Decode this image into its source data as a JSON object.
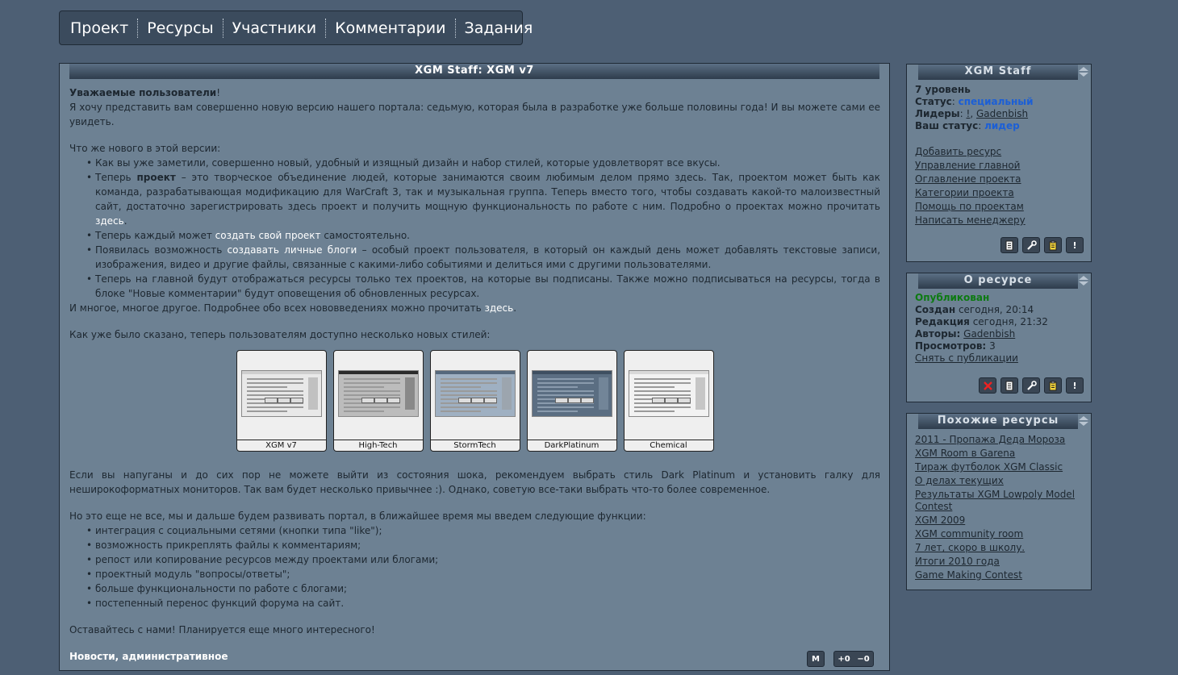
{
  "nav": {
    "items": [
      "Проект",
      "Ресурсы",
      "Участники",
      "Комментарии",
      "Задания"
    ]
  },
  "article": {
    "title": "XGM Staff: XGM v7",
    "greeting_bold": "Уважаемые пользователи",
    "greeting_rest": "!",
    "intro": "Я хочу представить вам совершенно новую версию нашего портала: седьмую, которая была в разработке уже больше половины года! И вы можете сами ее увидеть.",
    "whats_new": "Что же нового в этой версии:",
    "b1": "Как вы уже заметили, совершенно новый, удобный и изящный дизайн и набор стилей, которые удовлетворят все вкусы.",
    "b2_pre": "Теперь ",
    "b2_bold": "проект",
    "b2_text": " – это творческое объединение людей, которые занимаются своим любимым делом прямо здесь. Так, проектом может быть как команда, разрабатывающая модификацию для WarCraft 3, так и музыкальная группа. Теперь вместо того, чтобы создавать какой-то малоизвестный сайт, достаточно зарегистрировать здесь проект и получить мощную функциональность по работе с ним. Подробно о проектах можно прочитать ",
    "b2_link": "здесь",
    "b2_end": ".",
    "b3_pre": "Теперь каждый может ",
    "b3_link": "создать свой проект",
    "b3_end": " самостоятельно.",
    "b4_pre": "Появилась возможность ",
    "b4_link": "создавать личные блоги",
    "b4_end": " – особый проект пользователя, в который он каждый день может добавлять текстовые записи, изображения, видео и другие файлы, связанные с какими-либо событиями и делиться ими с другими пользователями.",
    "b5": "Теперь на главной будут отображаться ресурсы только тех проектов, на которые вы подписаны. Также можно подписываться на ресурсы, тогда в блоке \"Новые комментарии\" будут оповещения об обновленных ресурсах.",
    "more_pre": "И многое, многое другое. Подробнее обо всех нововведениях можно прочитать ",
    "more_link": "здесь",
    "more_end": ".",
    "styles_intro": "Как уже было сказано, теперь пользователям доступно несколько новых стилей:",
    "styles": [
      {
        "name": "XGM v7",
        "bg": "#e8e8e8",
        "bar": "#cfcfcf"
      },
      {
        "name": "High-Tech",
        "bg": "#bcbcbc",
        "bar": "#2b2b2b"
      },
      {
        "name": "StormTech",
        "bg": "#9fb0c2",
        "bar": "#55687c"
      },
      {
        "name": "DarkPlatinum",
        "bg": "#5b6e82",
        "bar": "#3e4f61"
      },
      {
        "name": "Chemical",
        "bg": "#f2f2f2",
        "bar": "#d9d9d9"
      }
    ],
    "shock": "Если вы напуганы и до сих пор не можете выйти из состояния шока, рекомендуем выбрать стиль Dark Platinum и установить галку для неширокоформатных мониторов. Так вам будет несколько привычнее :). Однако, советую все-таки выбрать что-то более современное.",
    "future_intro": "Но это еще не все, мы и дальше будем развивать портал, в ближайшее время мы введем следующие функции:",
    "future": [
      "интеграция с социальными сетями (кнопки типа \"like\");",
      "возможность прикреплять файлы к комментариям;",
      "репост или копирование ресурсов между проектами или блогами;",
      "проектный модуль \"вопросы/ответы\";",
      "больше функциональности по работе с блогами;",
      "постепенный перенос функций форума на сайт."
    ],
    "outro": "Оставайтесь с нами! Планируется еще много интересного!",
    "tag1": "Новости",
    "tag_sep": ", ",
    "tag2": "административное",
    "btn_m": "M",
    "btn_plus": "+0",
    "btn_minus": "−0"
  },
  "staff_panel": {
    "title": "XGM Staff",
    "level": "7 уровень",
    "status_label": "Статус",
    "status_value": "специальный",
    "leaders_label": "Лидеры",
    "leader1": "!",
    "leader2": "Gadenbish",
    "your_status_label": "Ваш статус",
    "your_status_value": "лидер",
    "colon": ":",
    "comma": ",",
    "links": [
      "Добавить ресурс",
      "Управление главной",
      "Оглавление проекта",
      "Категории проекта",
      "Помощь по проектам",
      "Написать менеджеру"
    ],
    "icon_names": [
      "document-icon",
      "wrench-icon",
      "clipboard-icon",
      "exclamation-icon"
    ]
  },
  "resource_panel": {
    "title": "О ресурсе",
    "published": "Опубликован",
    "created_label": "Создан",
    "created_value": "сегодня, 20:14",
    "edited_label": "Редакция",
    "edited_value": "сегодня, 21:32",
    "authors_label": "Авторы:",
    "author": "Gadenbish",
    "views_label": "Просмотров:",
    "views_value": "3",
    "unpublish": "Снять с публикации",
    "icon_names": [
      "delete-icon",
      "document-icon",
      "wrench-icon",
      "clipboard-icon",
      "exclamation-icon"
    ]
  },
  "similar_panel": {
    "title": "Похожие ресурсы",
    "items": [
      "2011 - Пропажа Деда Мороза",
      "XGM Room в Garena",
      "Тираж футболок XGM Classic",
      "О делах текущих",
      "Результаты XGM Lowpoly Model Contest",
      "XGM 2009",
      "XGM community room",
      "7 лет, скоро в школу.",
      "Итоги 2010 года",
      "Game Making Contest"
    ]
  },
  "colors": {
    "page_bg": "#4d5f74",
    "panel_bg": "#6d8193",
    "link_white": "#ffffff",
    "status_blue": "#1c5fd6",
    "published_green": "#0d7a12"
  }
}
